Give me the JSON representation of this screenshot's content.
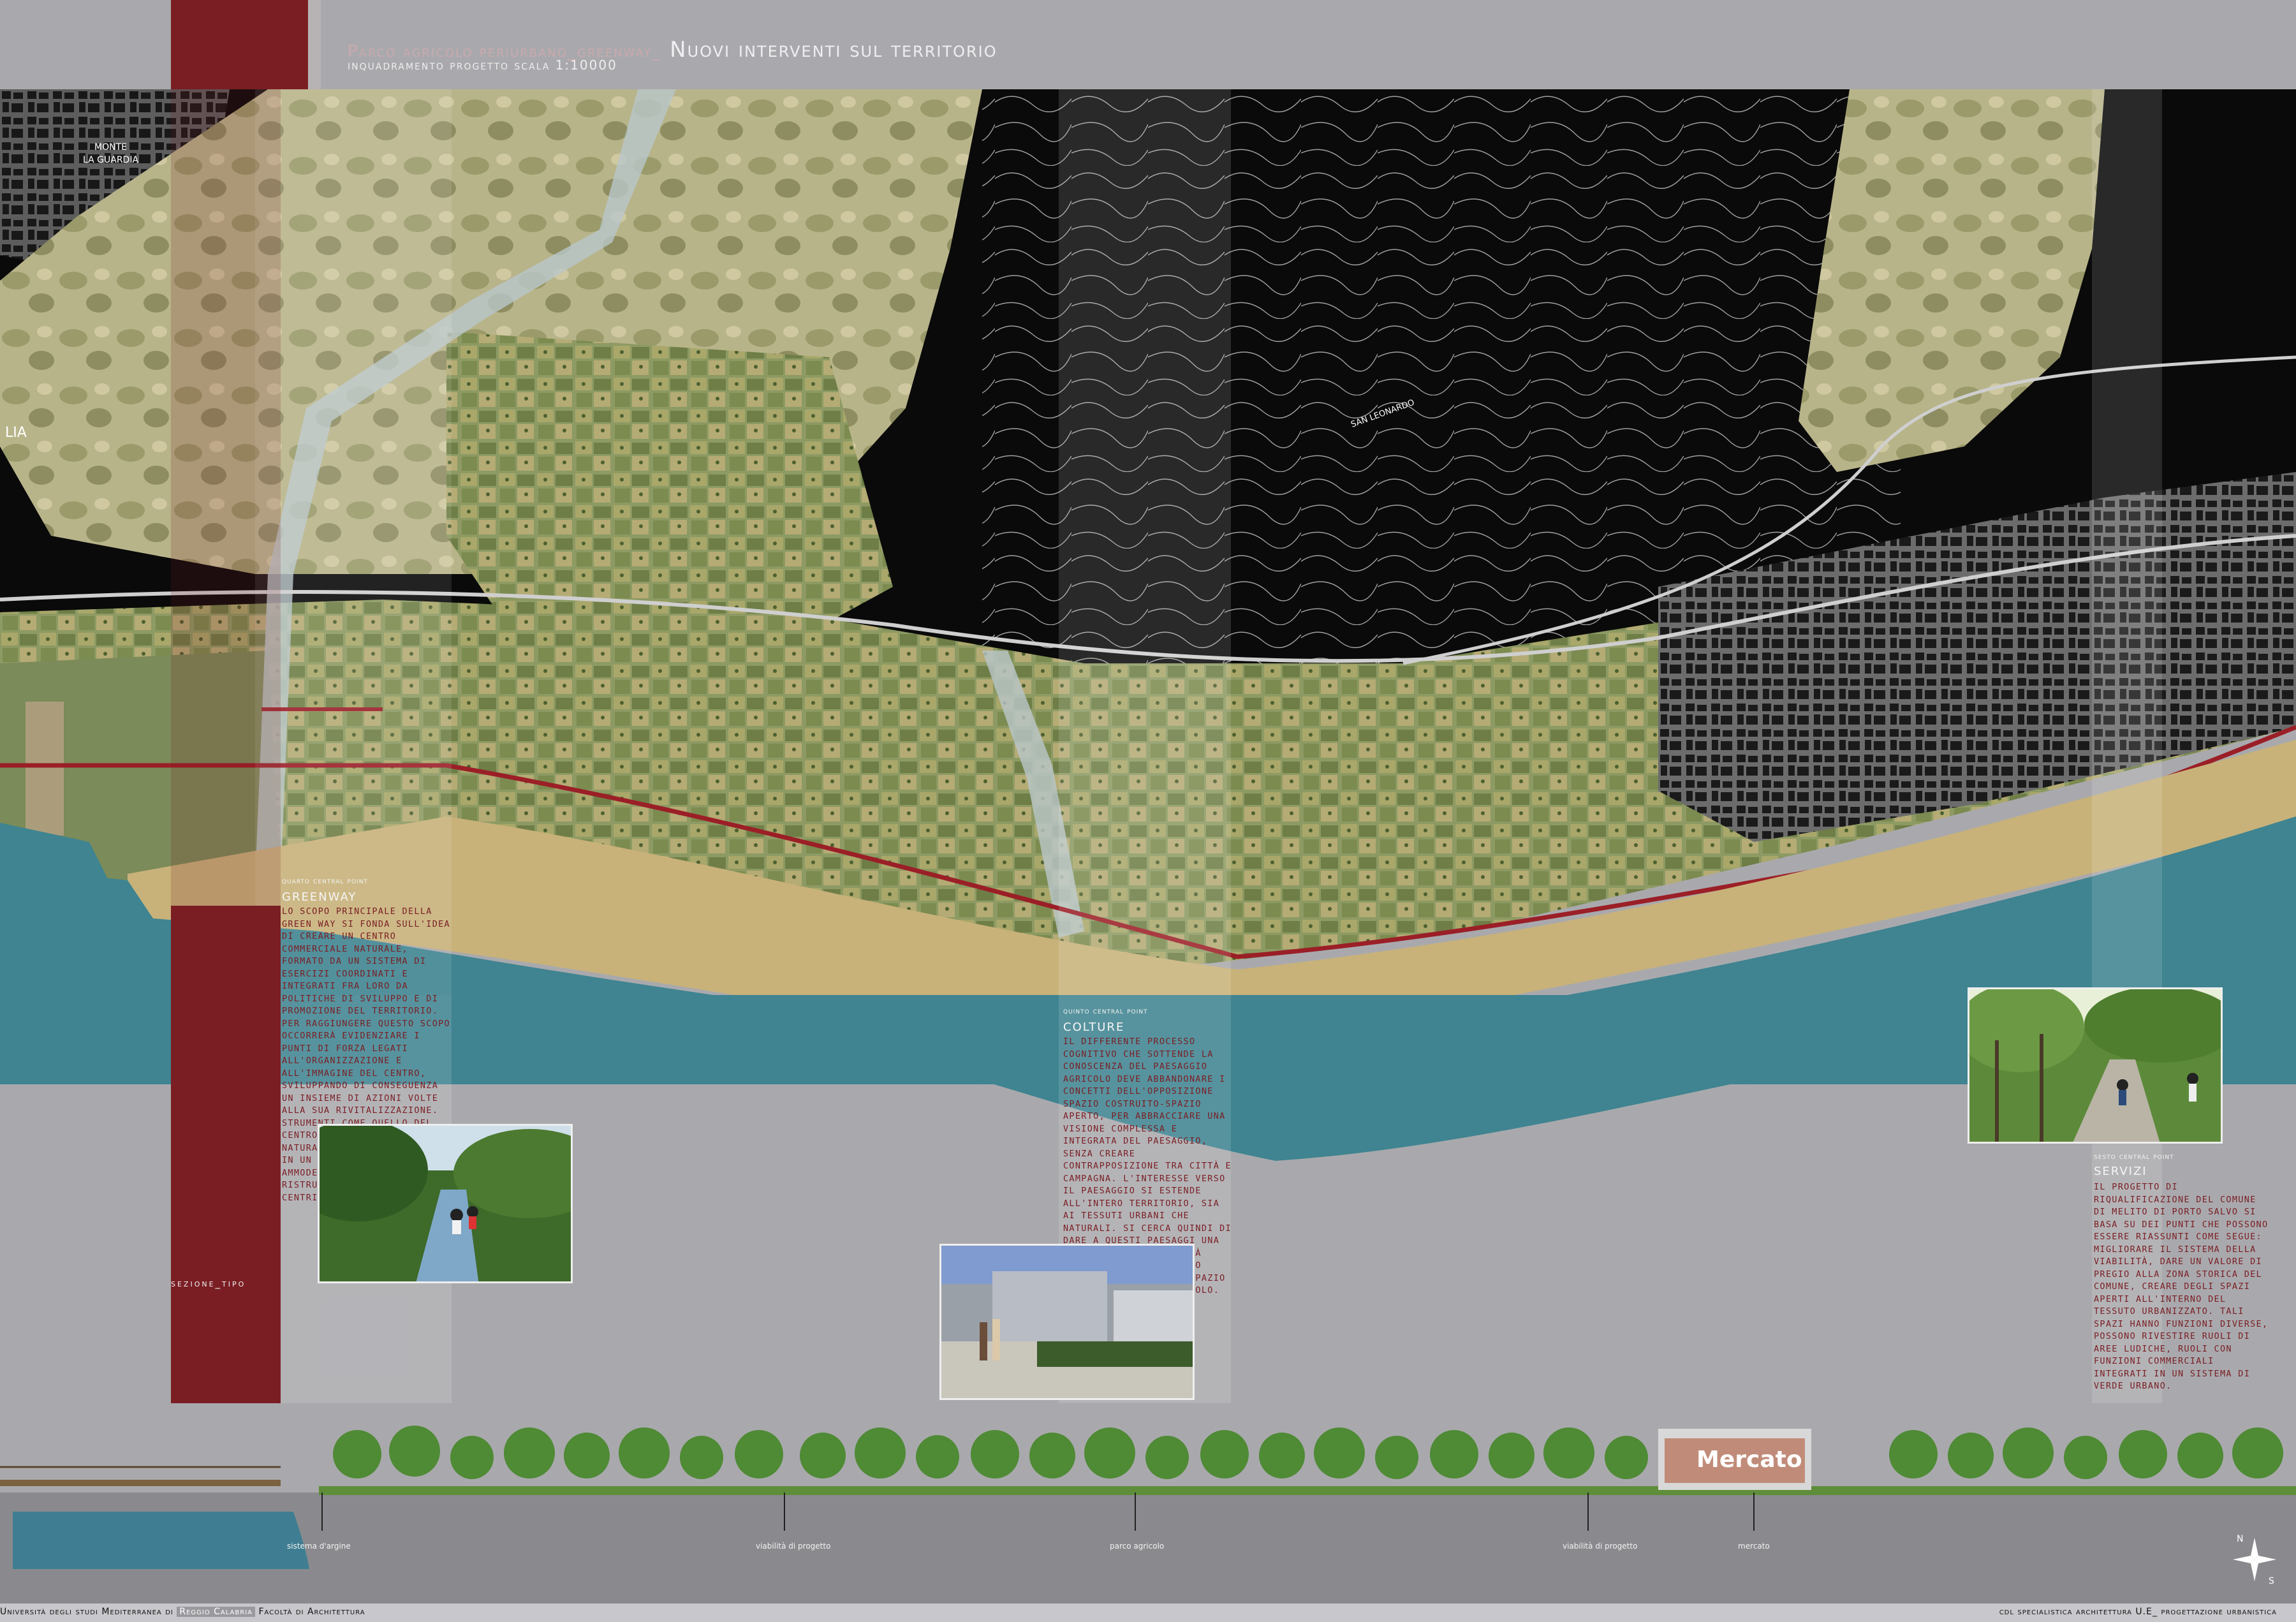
{
  "header": {
    "title_small": "Parco agricolo periurbano_greenway_",
    "title_big": " Nuovi interventi sul territorio",
    "subtitle": "inquadramento progetto scala 1:10000"
  },
  "map": {
    "labels": [
      "MONTE",
      "LA GUARDIA",
      "LIA",
      "SAN LEONARDO"
    ]
  },
  "panels": [
    {
      "label": "quarto central point",
      "heading": "Greenway",
      "body": "lo scopo principale della green way si fonda sull'idea di creare un centro commerciale naturale, formato da un sistema di esercizi coordinati e integrati fra loro da politiche di sviluppo e di promozione del territorio. per raggiungere questo scopo occorrerà evidenziare i punti di forza legati all'organizzazione e all'immagine del centro, sviluppando di conseguenza un insieme di azioni volte alla sua rivitalizzazione. strumenti come quello del centro commerciale e naturale possono inserirsi in un progetto comune di ammodernamento e ristrutturazione dei vari centri storici."
    },
    {
      "label": "quinto central point",
      "heading": "Colture",
      "body": "il differente processo cognitivo che sottende la conoscenza del paesaggio agricolo deve abbandonare i concetti dell'opposizione spazio costruito-spazio aperto, per abbracciare una visione complessa e integrata del paesaggio, senza creare contrapposizione tra città e campagna. l'interesse verso il paesaggio si estende all'intero territorio, sia ai tessuti urbani che naturali. si cerca quindi di dare a questi paesaggi una propria riconoscibilità all'interno del tessuto urbano, relazionando spazio costruito_spazio agricolo."
    },
    {
      "label": "sesto central point",
      "heading": "Servizi",
      "body": "il progetto di riqualificazione del comune di melito di porto salvo si basa su dei punti che possono essere riassunti come segue: migliorare il sistema della viabilità, dare un valore di pregio alla zona storica del comune, creare degli spazi aperti all'interno del tessuto urbanizzato. tali spazi hanno funzioni diverse, possono rivestire ruoli di aree ludiche, ruoli con funzioni commerciali integrati in un sistema di verde urbano."
    }
  ],
  "section": {
    "label": "sezione_tipo",
    "sign": "Mercato",
    "points": [
      "sistema d'argine",
      "viabilità di progetto",
      "parco agricolo",
      "viabilità di progetto",
      "mercato"
    ]
  },
  "compass": {
    "n": "N",
    "s": "S"
  },
  "footer": {
    "left_a": "Università degli studi Mediterranea di",
    "left_b": "Reggio Calabria",
    "left_c": "Facoltà di Architettura",
    "right": "cdl specialistica architettura U.E_ progettazione urbanistica"
  },
  "colors": {
    "background": "#a9a9ad",
    "band_red": "#7a1e24",
    "sea": "#3f8490",
    "beach": "#c8b27a"
  }
}
